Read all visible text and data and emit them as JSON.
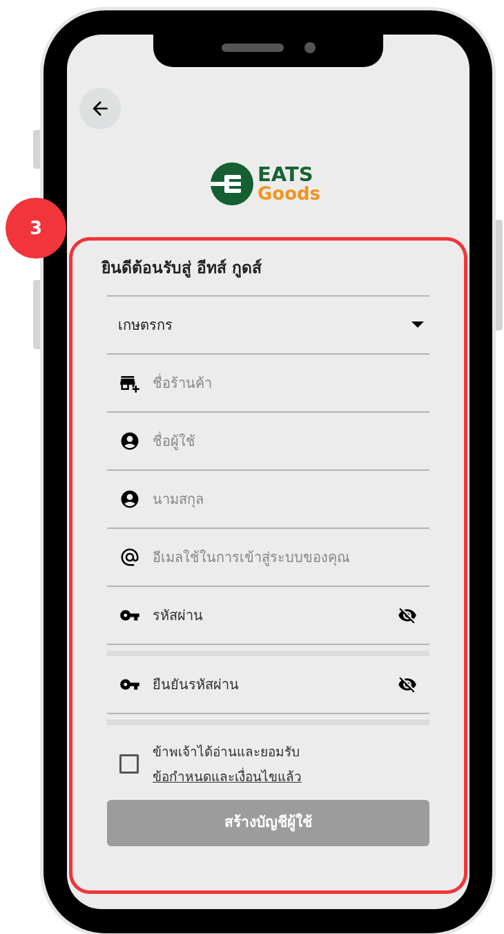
{
  "step_badge": "3",
  "logo": {
    "line1": "EATS",
    "line2": "Goods"
  },
  "form": {
    "title": "ยินดีต้อนรับสู่ อีทส์ กูดส์",
    "fields": [
      {
        "kind": "dropdown",
        "value": "เกษตรกร"
      },
      {
        "kind": "shop",
        "placeholder": "ชื่อร้านค้า"
      },
      {
        "kind": "person",
        "placeholder": "ชื่อผู้ใช้"
      },
      {
        "kind": "person",
        "placeholder": "นามสกุล"
      },
      {
        "kind": "email",
        "placeholder": "อีเมลใช้ในการเข้าสู่ระบบของคุณ"
      },
      {
        "kind": "password",
        "placeholder": "รหัสผ่าน"
      },
      {
        "kind": "password",
        "placeholder": "ยืนยันรหัสผ่าน"
      }
    ],
    "terms": {
      "checked": false,
      "text": "ข้าพเจ้าได้อ่านและยอมรับ",
      "link": "ข้อกำหนดและเงื่อนไขแล้ว"
    },
    "submit": {
      "label": "สร้างบัญชีผู้ใช้",
      "disabled": true
    }
  }
}
